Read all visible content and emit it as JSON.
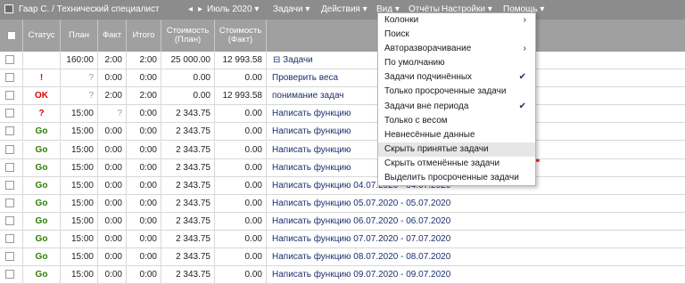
{
  "topbar": {
    "user": "Гаар С. / Технический специалист",
    "prev": "◂",
    "next": "▸",
    "period": "Июль 2020",
    "menus": [
      "Задачи",
      "Действия",
      "Вид",
      "Отчёты",
      "Настройки",
      "Помощь"
    ],
    "arrow": "▾"
  },
  "columns": [
    "Статус",
    "План",
    "Факт",
    "Итого",
    "Стоимость (План)",
    "Стоимость (Факт)"
  ],
  "summary": {
    "plan": "160:00",
    "fact": "2:00",
    "total": "2:00",
    "cost_plan": "25 000.00",
    "cost_fact": "12 993.58",
    "toggle": "⊟",
    "label": "Задачи"
  },
  "rows": [
    {
      "status": "!",
      "plan": "?",
      "fact": "0:00",
      "total": "0:00",
      "cost_plan": "0.00",
      "cost_fact": "0.00",
      "task": "Проверить веса"
    },
    {
      "status": "OK",
      "plan": "?",
      "fact": "2:00",
      "total": "2:00",
      "cost_plan": "0.00",
      "cost_fact": "12 993.58",
      "task": "понимание задач"
    },
    {
      "status": "?",
      "plan": "15:00",
      "fact": "?",
      "total": "0:00",
      "cost_plan": "2 343.75",
      "cost_fact": "0.00",
      "task": "Написать функцию"
    },
    {
      "status": "Go",
      "plan": "15:00",
      "fact": "0:00",
      "total": "0:00",
      "cost_plan": "2 343.75",
      "cost_fact": "0.00",
      "task": "Написать функцию"
    },
    {
      "status": "Go",
      "plan": "15:00",
      "fact": "0:00",
      "total": "0:00",
      "cost_plan": "2 343.75",
      "cost_fact": "0.00",
      "task": "Написать функцию"
    },
    {
      "status": "Go",
      "plan": "15:00",
      "fact": "0:00",
      "total": "0:00",
      "cost_plan": "2 343.75",
      "cost_fact": "0.00",
      "task": "Написать функцию"
    },
    {
      "status": "Go",
      "plan": "15:00",
      "fact": "0:00",
      "total": "0:00",
      "cost_plan": "2 343.75",
      "cost_fact": "0.00",
      "task": "Написать функцию 04.07.2020 - 04.07.2020"
    },
    {
      "status": "Go",
      "plan": "15:00",
      "fact": "0:00",
      "total": "0:00",
      "cost_plan": "2 343.75",
      "cost_fact": "0.00",
      "task": "Написать функцию 05.07.2020 - 05.07.2020"
    },
    {
      "status": "Go",
      "plan": "15:00",
      "fact": "0:00",
      "total": "0:00",
      "cost_plan": "2 343.75",
      "cost_fact": "0.00",
      "task": "Написать функцию 06.07.2020 - 06.07.2020"
    },
    {
      "status": "Go",
      "plan": "15:00",
      "fact": "0:00",
      "total": "0:00",
      "cost_plan": "2 343.75",
      "cost_fact": "0.00",
      "task": "Написать функцию 07.07.2020 - 07.07.2020"
    },
    {
      "status": "Go",
      "plan": "15:00",
      "fact": "0:00",
      "total": "0:00",
      "cost_plan": "2 343.75",
      "cost_fact": "0.00",
      "task": "Написать функцию 08.07.2020 - 08.07.2020"
    },
    {
      "status": "Go",
      "plan": "15:00",
      "fact": "0:00",
      "total": "0:00",
      "cost_plan": "2 343.75",
      "cost_fact": "0.00",
      "task": "Написать функцию 09.07.2020 - 09.07.2020"
    }
  ],
  "menu": [
    {
      "label": "Колонки",
      "right": "›"
    },
    {
      "label": "Поиск",
      "right": ""
    },
    {
      "label": "Авторазворачивание",
      "right": "›"
    },
    {
      "label": "По умолчанию",
      "right": ""
    },
    {
      "label": "Задачи подчинённых",
      "right": "✔"
    },
    {
      "label": "Только просроченные задачи",
      "right": ""
    },
    {
      "label": "Задачи вне периода",
      "right": "✔"
    },
    {
      "label": "Только с весом",
      "right": ""
    },
    {
      "label": "Невнесённые данные",
      "right": ""
    },
    {
      "label": "Скрыть принятые задачи",
      "right": ""
    },
    {
      "label": "Скрыть отменённые задачи",
      "right": ""
    },
    {
      "label": "Выделить просроченные задачи",
      "right": ""
    }
  ],
  "menu_highlight_index": 9,
  "colors": {
    "ok": "#e00000",
    "go": "#2e7d00",
    "warn": "#e00000",
    "header": "#a0a0a0",
    "topbar": "#8c8c8c",
    "annotation": "#e0302a"
  }
}
